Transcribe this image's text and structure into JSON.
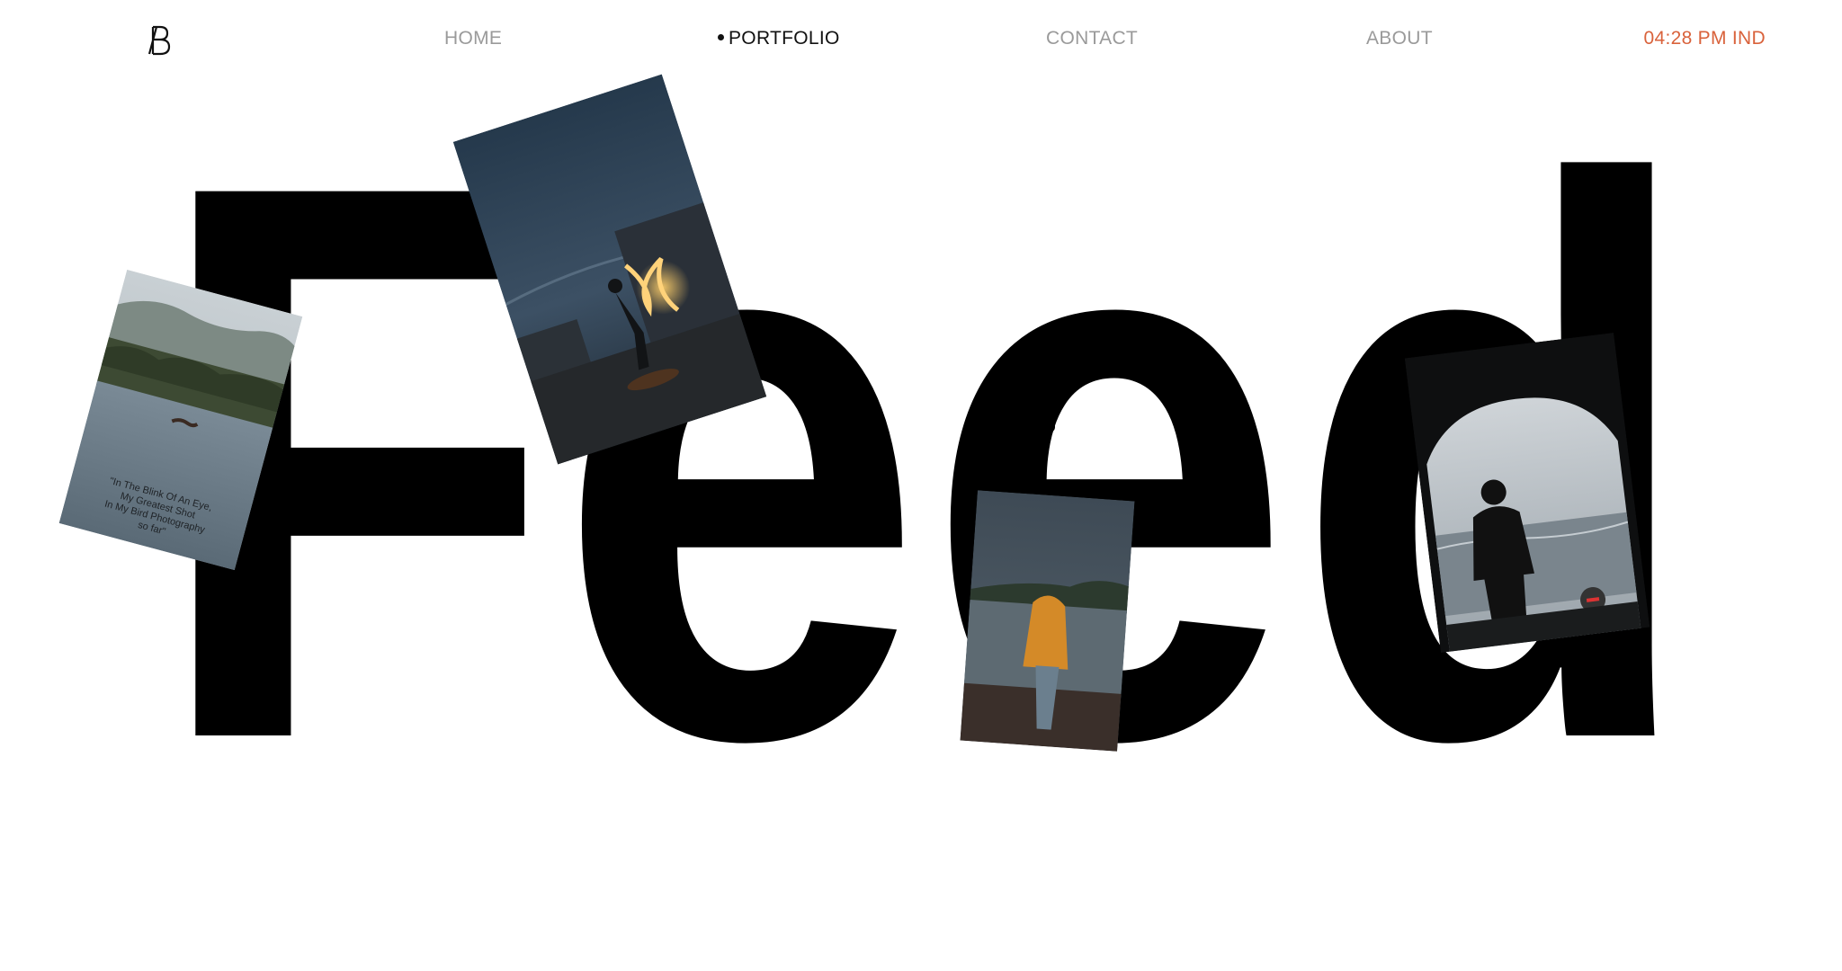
{
  "logo": {
    "icon": "monogram-logo-icon",
    "text": "B"
  },
  "nav": {
    "home": "HOME",
    "portfolio": "PORTFOLIO",
    "contact": "CONTACT",
    "about": "ABOUT",
    "active": "portfolio"
  },
  "clock": {
    "text": "04:28 PM IND",
    "color": "#d9623b"
  },
  "hero": {
    "word": "Feed",
    "color": "#000000"
  },
  "photos": {
    "lake": {
      "caption": "\"In The Blink Of An Eye,\nMy Greatest Shot\nIn My Bird Photography\nso far\""
    }
  }
}
